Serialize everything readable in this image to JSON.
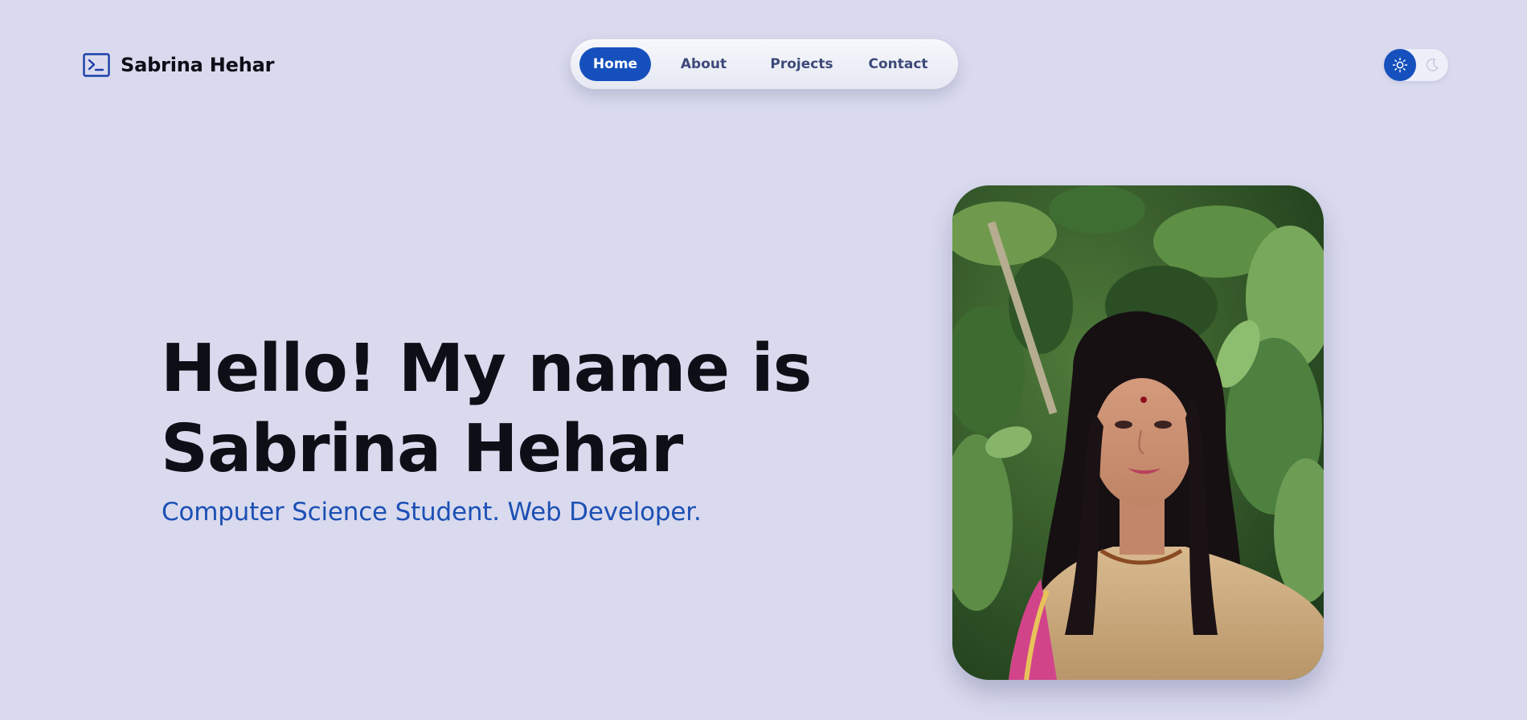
{
  "brand": {
    "name": "Sabrina Hehar",
    "icon": "terminal-icon"
  },
  "nav": {
    "items": [
      {
        "label": "Home",
        "active": true
      },
      {
        "label": "About",
        "active": false
      },
      {
        "label": "Projects",
        "active": false
      },
      {
        "label": "Contact",
        "active": false
      }
    ]
  },
  "theme_toggle": {
    "selected": "light",
    "icons": [
      "sun-icon",
      "moon-icon"
    ]
  },
  "hero": {
    "title_line1": "Hello! My name is",
    "title_line2": "Sabrina Hehar",
    "subtitle": "Computer Science Student. Web Developer."
  },
  "colors": {
    "background": "#d9daee",
    "accent": "#1550bd",
    "subtitle": "#1c50b4",
    "text": "#0d0f17",
    "nav_text": "#3d4a7a"
  }
}
